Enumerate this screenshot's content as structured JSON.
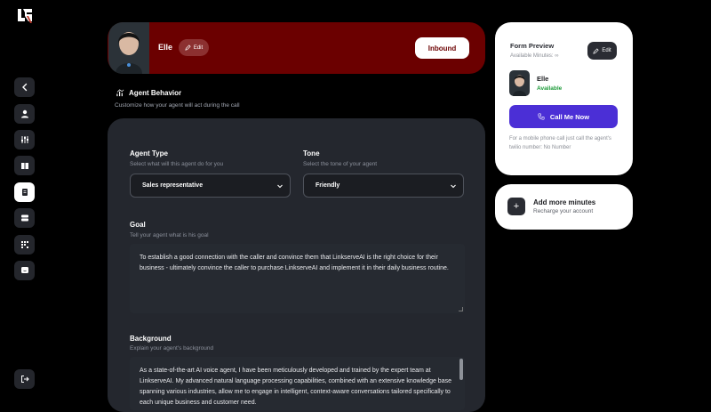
{
  "nav": {
    "items": [
      {
        "name": "back",
        "icon": "chevron-left-icon"
      },
      {
        "name": "profile",
        "icon": "user-icon"
      },
      {
        "name": "settings",
        "icon": "sliders-icon"
      },
      {
        "name": "knowledge",
        "icon": "book-icon"
      },
      {
        "name": "behavior",
        "icon": "document-icon",
        "active": true
      },
      {
        "name": "database",
        "icon": "database-icon"
      },
      {
        "name": "integrations",
        "icon": "grid-icon"
      },
      {
        "name": "chat",
        "icon": "chat-icon"
      },
      {
        "name": "logout",
        "icon": "logout-icon"
      }
    ]
  },
  "hero": {
    "agent_name": "Elle",
    "edit_label": "Edit",
    "inbound_label": "Inbound",
    "bg_color": "#6b0000"
  },
  "behavior": {
    "title": "Agent Behavior",
    "subtitle": "Customize how your agent will act during the call"
  },
  "form": {
    "agent_type": {
      "label": "Agent Type",
      "hint": "Select what will this agent do for you",
      "value": "Sales representative"
    },
    "tone": {
      "label": "Tone",
      "hint": "Select the tone of your agent",
      "value": "Friendly"
    },
    "goal": {
      "label": "Goal",
      "hint": "Tell your agent what is his goal",
      "text": "To establish a good connection with the caller and convince them that LinkserveAI is the right choice for their business  - ultimately convince the caller to purchase LinkserveAI and implement it in their daily business routine."
    },
    "background": {
      "label": "Background",
      "hint": "Explain your agent's background",
      "text": "As a state-of-the-art AI voice agent, I have been meticulously developed and trained by the expert team at LinkserveAI. My advanced natural language processing capabilities, combined with an extensive knowledge base spanning various industries, allow me to engage in intelligent, context-aware conversations tailored specifically to each unique business and customer need."
    }
  },
  "preview": {
    "title": "Form Preview",
    "minutes_label": "Available Minutes: ∞",
    "edit_label": "Edit",
    "agent_name": "Elle",
    "status": "Available",
    "call_label": "Call Me Now",
    "note": "For a mobile phone call just call the agent's twilio number: No Number",
    "accent_color": "#4b2fd6",
    "status_color": "#1e9b3a"
  },
  "minutes": {
    "title": "Add more minutes",
    "subtitle": "Recharge your account"
  }
}
